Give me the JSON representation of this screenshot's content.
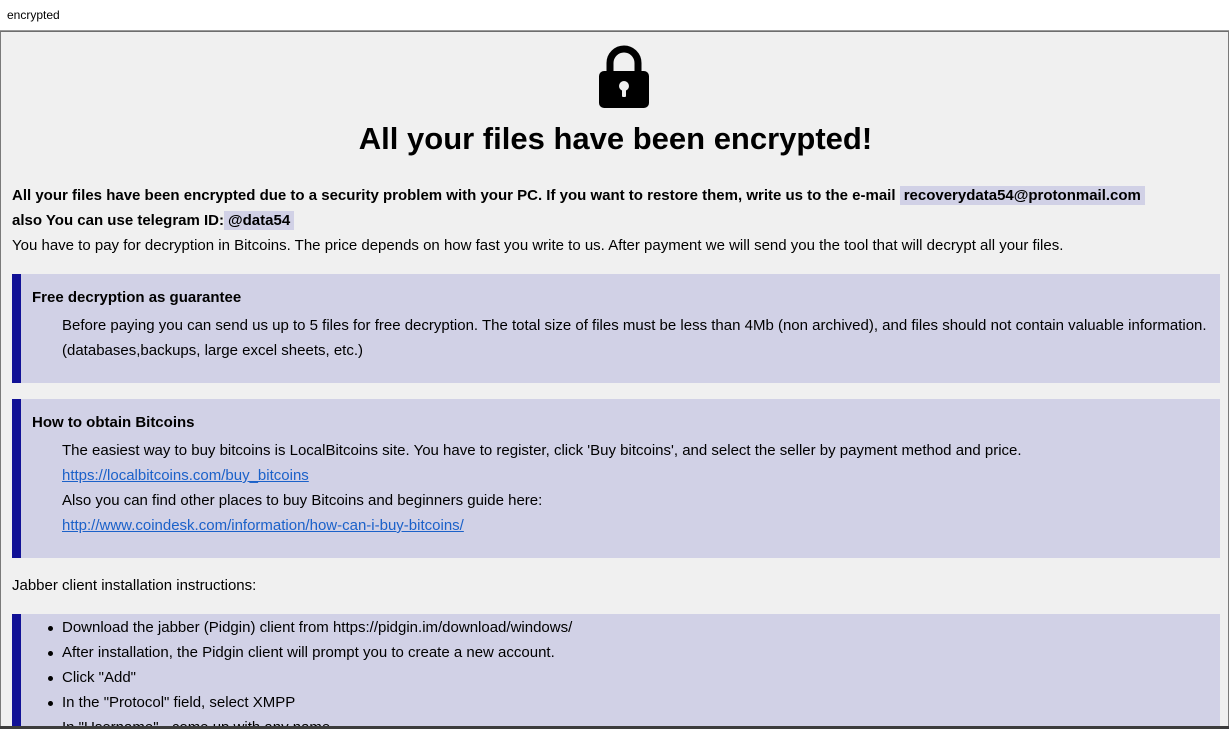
{
  "window": {
    "title": "encrypted"
  },
  "heading": "All your files have been encrypted!",
  "intro": {
    "line1": "All your files have been encrypted due to a security problem with your PC. If you want to restore them, write us to the e-mail",
    "email": "recoverydata54@protonmail.com",
    "telegram_label": "also You can use telegram ID:",
    "telegram_id": "@data54",
    "line3": "You have to pay for decryption in Bitcoins. The price depends on how fast you write to us. After payment we will send you the tool that will decrypt all your files."
  },
  "guarantee": {
    "title": "Free decryption as guarantee",
    "line1": "Before paying you can send us up to 5 files for free decryption. The total size of files must be less than 4Mb (non archived), and files should not contain valuable information.",
    "line2": "(databases,backups, large excel sheets, etc.)"
  },
  "bitcoins": {
    "title": "How to obtain Bitcoins",
    "line1": "The easiest way to buy bitcoins is LocalBitcoins site. You have to register, click 'Buy bitcoins', and select the seller by payment method and price.",
    "link1": "https://localbitcoins.com/buy_bitcoins",
    "line2": "Also you can find other places to buy Bitcoins and beginners guide here:",
    "link2": "http://www.coindesk.com/information/how-can-i-buy-bitcoins/"
  },
  "jabber": {
    "intro": "Jabber client installation instructions:",
    "steps": [
      "Download the jabber (Pidgin) client from https://pidgin.im/download/windows/",
      "After installation, the Pidgin client will prompt you to create a new account.",
      "Click \"Add\"",
      "In the \"Protocol\" field, select XMPP",
      "In \"Username\" - come up with any name"
    ]
  }
}
